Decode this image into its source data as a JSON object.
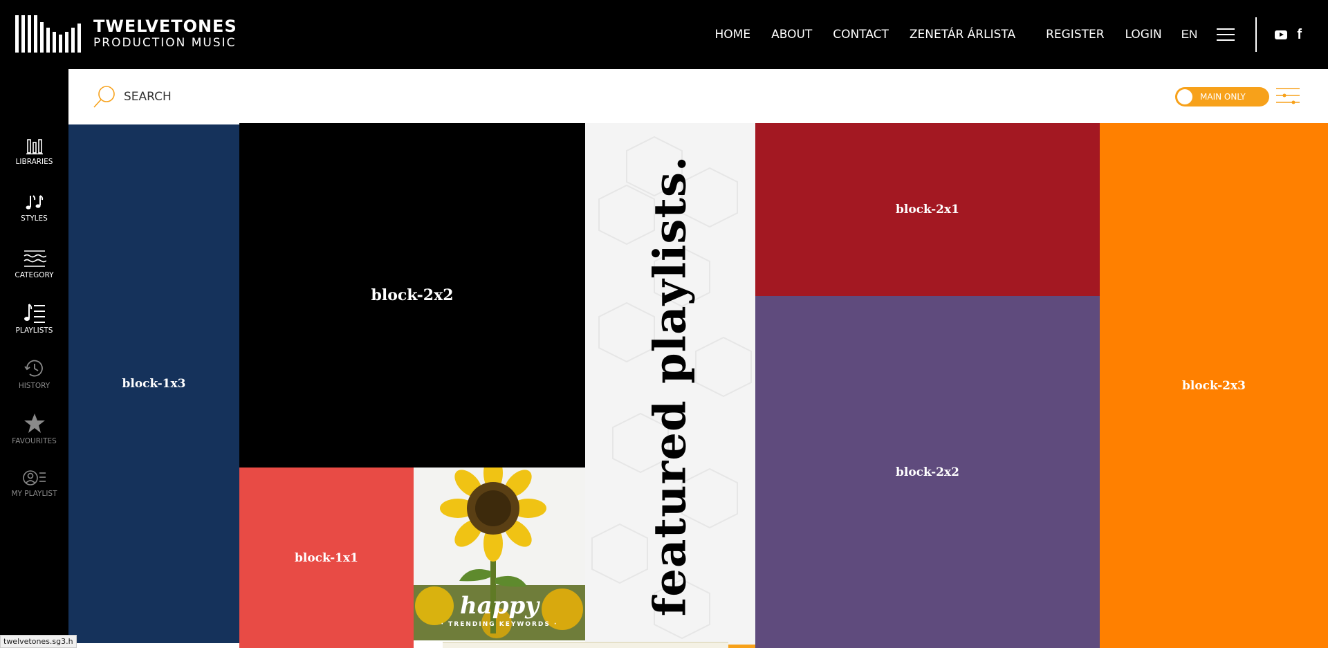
{
  "header": {
    "logo_title": "TWELVETONES",
    "logo_subtitle": "PRODUCTION MUSIC",
    "nav": [
      "HOME",
      "ABOUT",
      "CONTACT",
      "ZENETÁR ÁRLISTA"
    ],
    "register": "REGISTER",
    "login": "LOGIN",
    "language": "EN",
    "social": [
      "youtube-icon",
      "facebook-icon"
    ]
  },
  "sidebar": {
    "items": [
      {
        "label": "LIBRARIES",
        "icon": "libraries-icon"
      },
      {
        "label": "STYLES",
        "icon": "music-notes-icon"
      },
      {
        "label": "CATEGORY",
        "icon": "waves-icon"
      },
      {
        "label": "PLAYLISTS",
        "icon": "playlist-icon"
      },
      {
        "label": "HISTORY",
        "icon": "history-icon"
      },
      {
        "label": "FAVOURITES",
        "icon": "star-icon"
      },
      {
        "label": "MY PLAYLIST",
        "icon": "user-list-icon"
      }
    ]
  },
  "search": {
    "placeholder": "SEARCH",
    "toggle_label": "MAIN ONLY"
  },
  "blocks": {
    "navy": "block-1x3",
    "black": "block-2x2",
    "coral": "block-1x1",
    "crimson": "block-2x1",
    "purple": "block-2x2",
    "orange": "block-2x3",
    "featured": "featured playlists.",
    "sunflower_title": "happy",
    "sunflower_sub": "· TRENDING KEYWORDS ·"
  },
  "colors": {
    "navy": "#15325b",
    "coral": "#e84b45",
    "crimson": "#a31822",
    "purple": "#5f4b7d",
    "orange": "#ff8000",
    "toggle": "#f7a11a"
  },
  "status_url": "twelvetones.sg3.h"
}
